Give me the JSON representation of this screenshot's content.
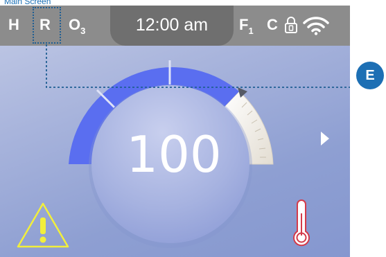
{
  "caption": "Main Screen",
  "statusbar": {
    "heater": "H",
    "ready_mode": "R",
    "ozone": "O",
    "ozone_sub": "3",
    "time": "12:00 am",
    "filter": "F",
    "filter_sub": "1",
    "cleanup": "C",
    "lock_icon": "padlock-icon",
    "wifi_icon": "wifi-icon"
  },
  "callout": {
    "label": "E"
  },
  "main": {
    "temperature_setpoint": "100",
    "next_icon": "arrow-right-icon",
    "warning_icon": "warning-icon",
    "thermometer_icon": "thermometer-icon"
  },
  "colors": {
    "dial_fill": "#5a6ef0",
    "dial_track": "#ffffff",
    "warning": "#f2ef3b",
    "thermometer": "#d43a4a",
    "callout": "#1d6fb4"
  }
}
